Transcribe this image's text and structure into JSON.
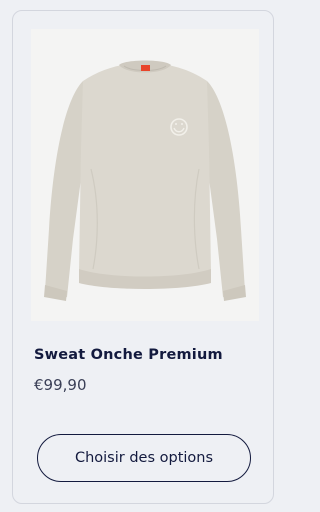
{
  "product": {
    "image_alt": "Sweat Onche Premium",
    "title": "Sweat Onche Premium",
    "price": "€99,90",
    "choose_options_label": "Choisir des options"
  },
  "colors": {
    "background": "#eef0f4",
    "title_text": "#131a3e",
    "price_text": "#3a3f56",
    "garment": "#d8d4cb",
    "label_tag": "#e8442a"
  }
}
